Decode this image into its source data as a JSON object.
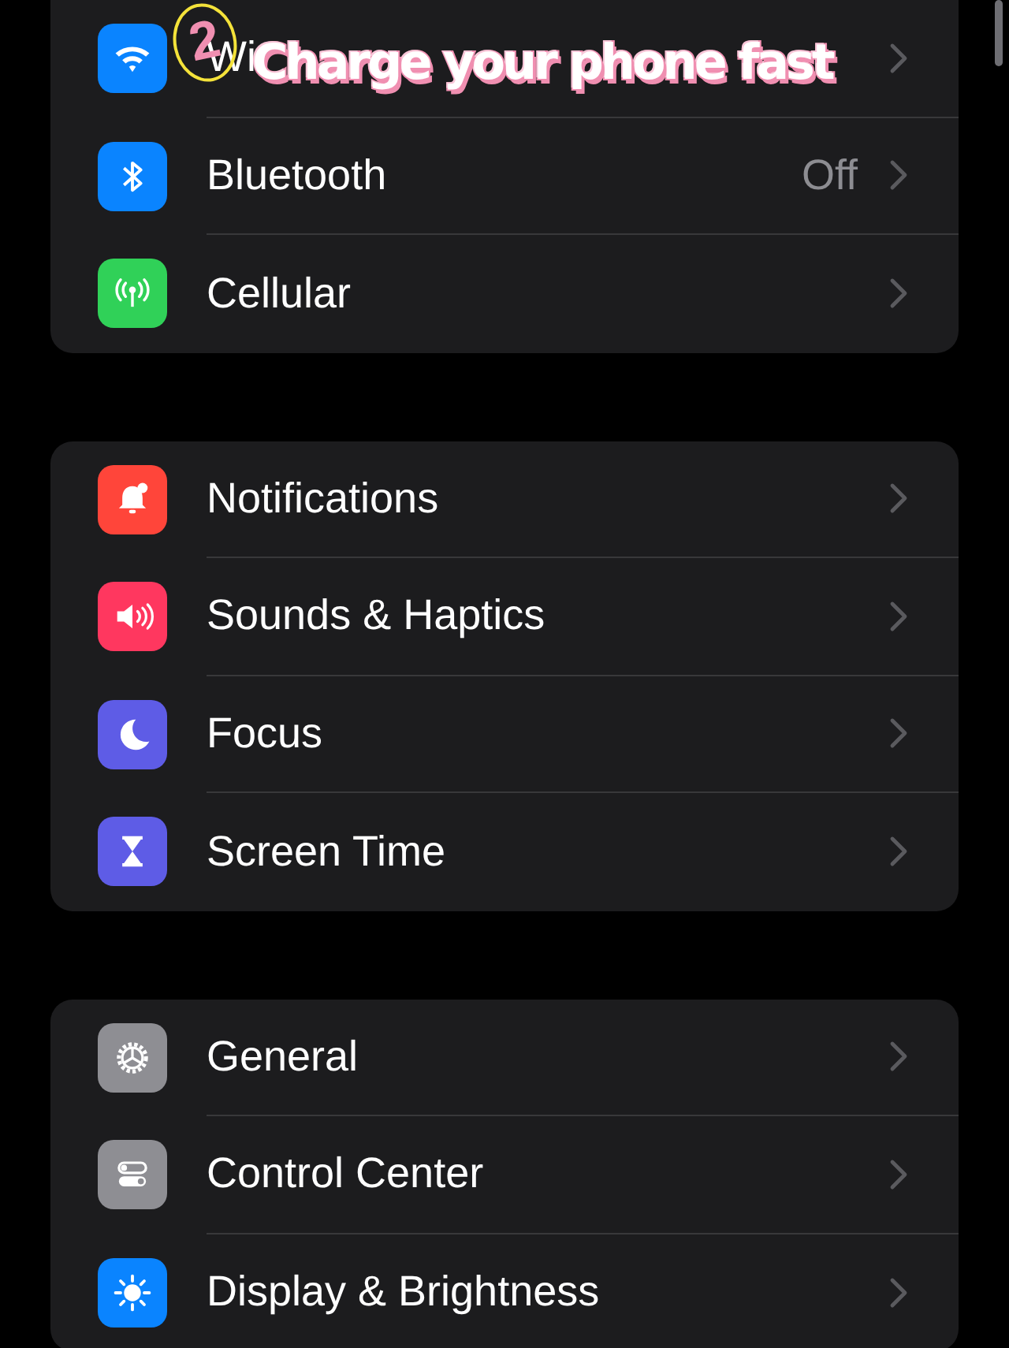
{
  "overlay": {
    "caption": "Charge your phone fast",
    "step": "2"
  },
  "groups": [
    {
      "rows": [
        {
          "kind": "wifi",
          "color": "#0a84ff",
          "label": "Wi"
        },
        {
          "kind": "bluetooth",
          "color": "#0a84ff",
          "label": "Bluetooth",
          "value": "Off"
        },
        {
          "kind": "antenna",
          "color": "#30d158",
          "label": "Cellular"
        }
      ]
    },
    {
      "rows": [
        {
          "kind": "bell",
          "color": "#ff453a",
          "label": "Notifications"
        },
        {
          "kind": "speaker",
          "color": "#ff375f",
          "label": "Sounds & Haptics"
        },
        {
          "kind": "moon",
          "color": "#5e5ce6",
          "label": "Focus"
        },
        {
          "kind": "hourglass",
          "color": "#5e5ce6",
          "label": "Screen Time"
        }
      ]
    },
    {
      "rows": [
        {
          "kind": "gear",
          "color": "#8e8e93",
          "label": "General"
        },
        {
          "kind": "toggles",
          "color": "#8e8e93",
          "label": "Control Center"
        },
        {
          "kind": "sun",
          "color": "#0a84ff",
          "label": "Display & Brightness"
        }
      ]
    }
  ]
}
